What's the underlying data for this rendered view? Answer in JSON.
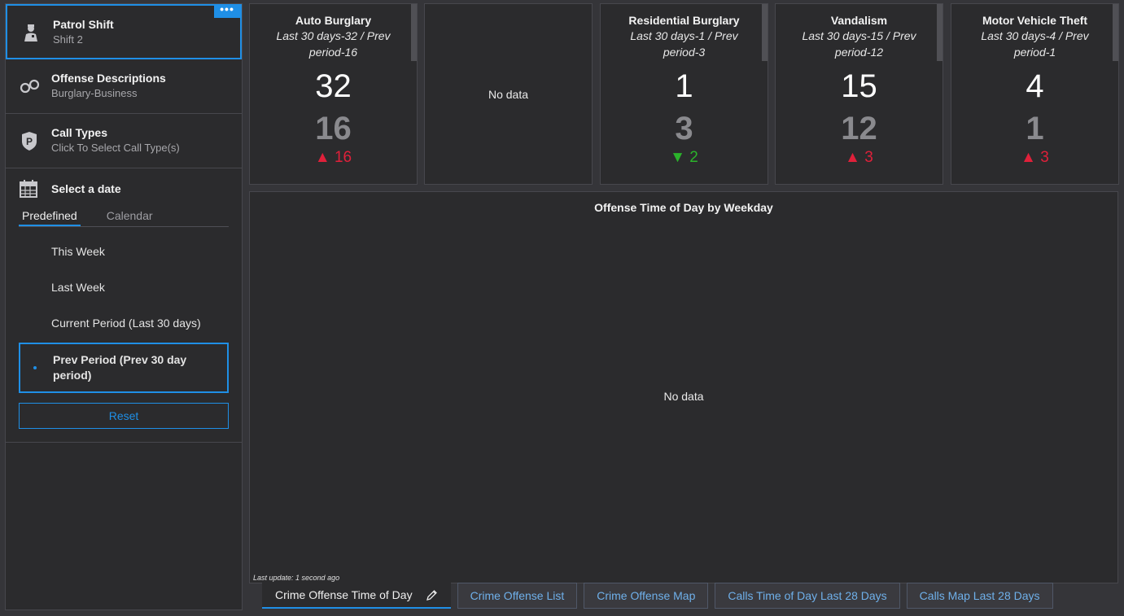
{
  "sidebar": {
    "items": [
      {
        "title": "Patrol Shift",
        "subtitle": "Shift 2",
        "icon": "officer-icon"
      },
      {
        "title": "Offense Descriptions",
        "subtitle": "Burglary-Business",
        "icon": "handcuffs-icon"
      },
      {
        "title": "Call Types",
        "subtitle": "Click To Select Call Type(s)",
        "icon": "police-badge-icon"
      }
    ],
    "more_label": "•••",
    "date": {
      "title": "Select a date",
      "tabs": [
        "Predefined",
        "Calendar"
      ],
      "options": [
        "This Week",
        "Last Week",
        "Current Period (Last 30 days)",
        "Prev Period (Prev 30 day period)"
      ],
      "reset_label": "Reset"
    }
  },
  "cards": [
    {
      "title": "Auto Burglary",
      "desc": "Last 30 days-32 / Prev period-16",
      "value": "32",
      "prev": "16",
      "delta": "▲ 16",
      "direction": "up"
    },
    {
      "nodata": "No data"
    },
    {
      "title": "Residential Burglary",
      "desc": "Last 30 days-1 / Prev period-3",
      "value": "1",
      "prev": "3",
      "delta": "▼ 2",
      "direction": "down"
    },
    {
      "title": "Vandalism",
      "desc": "Last 30 days-15 / Prev period-12",
      "value": "15",
      "prev": "12",
      "delta": "▲ 3",
      "direction": "up"
    },
    {
      "title": "Motor Vehicle Theft",
      "desc": "Last 30 days-4 / Prev period-1",
      "value": "4",
      "prev": "1",
      "delta": "▲ 3",
      "direction": "up"
    }
  ],
  "chart": {
    "title": "Offense Time of Day by Weekday",
    "nodata": "No data",
    "last_update": "Last update: 1 second ago"
  },
  "bottom_tabs": [
    "Crime Offense Time of Day",
    "Crime Offense List",
    "Crime Offense Map",
    "Calls Time of Day Last 28 Days",
    "Calls Map Last 28 Days"
  ],
  "colors": {
    "accent": "#1f8fe6",
    "up": "#e0203a",
    "down": "#2bb32b"
  }
}
